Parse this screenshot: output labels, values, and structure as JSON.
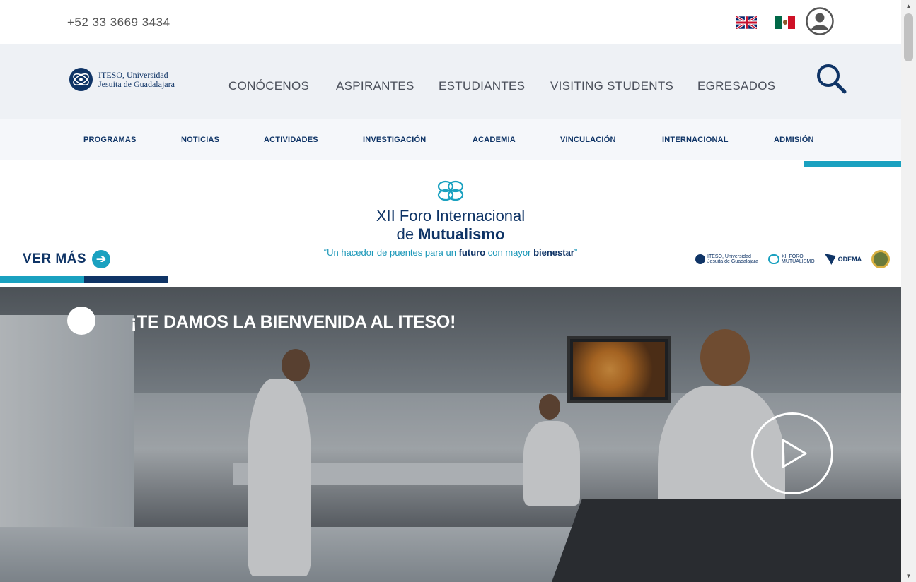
{
  "topbar": {
    "phone": "+52 33 3669 3434",
    "flags": [
      "uk-flag-icon",
      "mexico-flag-icon"
    ],
    "user_icon": "user-account-icon"
  },
  "header": {
    "logo_text_line1": "ITESO, Universidad",
    "logo_text_line2": "Jesuita de Guadalajara",
    "nav": [
      "CONÓCENOS",
      "ASPIRANTES",
      "ESTUDIANTES",
      "VISITING STUDENTS",
      "EGRESADOS"
    ],
    "search_icon": "search-icon"
  },
  "subnav": {
    "items": [
      "PROGRAMAS",
      "NOTICIAS",
      "ACTIVIDADES",
      "INVESTIGACIÓN",
      "ACADEMIA",
      "VINCULACIÓN",
      "INTERNACIONAL",
      "ADMISIÓN"
    ]
  },
  "banner": {
    "title_line1": "XII Foro Internacional",
    "title_line2_prefix": "de ",
    "title_line2_bold": "Mutualismo",
    "tagline_part1": "“Un hacedor de puentes para un ",
    "tagline_bold1": "futuro",
    "tagline_part2": " con mayor ",
    "tagline_bold2": "bienestar",
    "tagline_part3": "”",
    "ver_mas": "VER MÁS",
    "partners": [
      {
        "line1": "ITESO, Universidad",
        "line2": "Jesuita de Guadalajara"
      },
      {
        "line1": "XII FORO",
        "line2": "MUTUALISMO"
      },
      {
        "line1": "ODEMA",
        "line2": ""
      }
    ]
  },
  "hero": {
    "title": "¡TE DAMOS LA BIENVENIDA AL ITESO!",
    "play_icon": "play-icon"
  },
  "colors": {
    "brand_navy": "#0f3466",
    "accent_teal": "#1aa1c0",
    "nav_bg": "#eef1f5"
  }
}
